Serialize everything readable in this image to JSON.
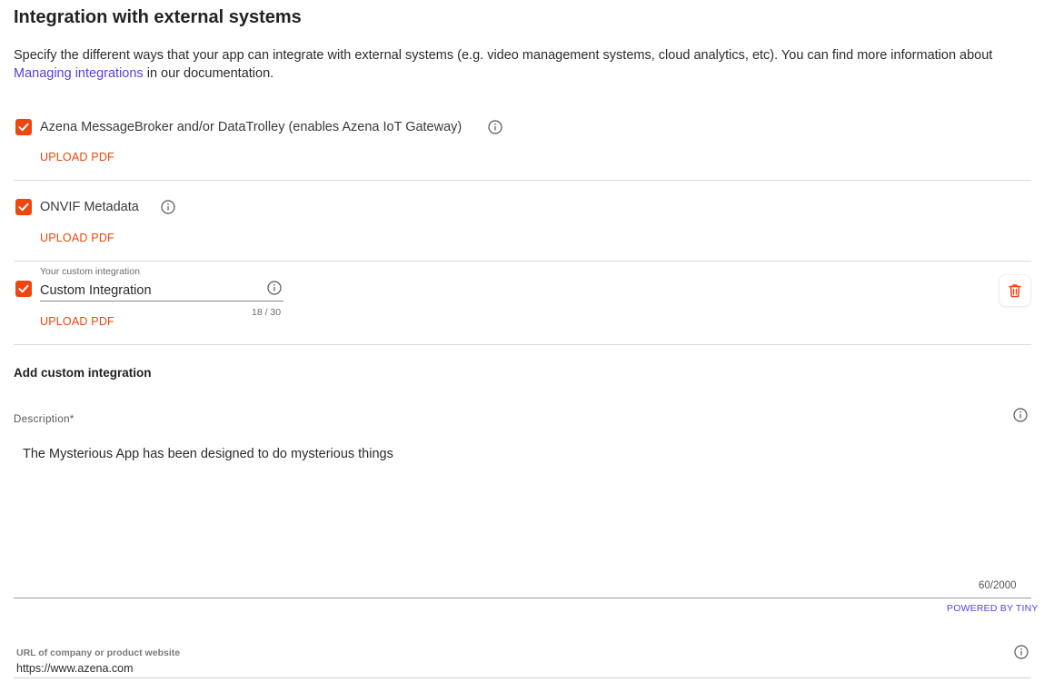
{
  "section": {
    "title": "Integration with external systems",
    "intro_before_link": "Specify the different ways that your app can integrate with external systems (e.g. video management systems, cloud analytics, etc). You can find more information about ",
    "intro_link": "Managing integrations",
    "intro_after_link": " in our documentation."
  },
  "integrations": [
    {
      "label": "Azena MessageBroker and/or DataTrolley (enables Azena IoT Gateway)",
      "checked": true,
      "upload_label": "UPLOAD PDF"
    },
    {
      "label": "ONVIF Metadata",
      "checked": true,
      "upload_label": "UPLOAD PDF"
    }
  ],
  "custom_integration": {
    "field_label": "Your custom integration",
    "value": "Custom Integration",
    "char_count": "18 / 30",
    "checked": true,
    "upload_label": "UPLOAD PDF"
  },
  "add_custom": {
    "label": "Add custom integration"
  },
  "description": {
    "label": "Description*",
    "text": "The Mysterious App has been designed to do mysterious things",
    "char_count": "60/2000",
    "powered_by": "POWERED BY TINY"
  },
  "website": {
    "label": "URL of company or product website",
    "value": "https://www.azena.com"
  },
  "colors": {
    "accent": "#f0450e",
    "link": "#5b3fd8"
  },
  "icons": {
    "checkbox": "check-icon",
    "info": "info-icon",
    "delete": "trash-icon"
  }
}
